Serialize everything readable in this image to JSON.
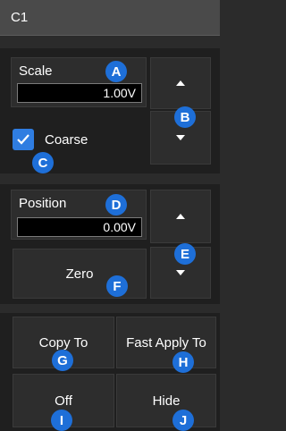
{
  "window": {
    "title": "C1"
  },
  "scale": {
    "label": "Scale",
    "value": "1.00V",
    "up_icon": "triangle-up",
    "down_icon": "triangle-down"
  },
  "coarse": {
    "label": "Coarse",
    "checked": true
  },
  "position": {
    "label": "Position",
    "value": "0.00V",
    "up_icon": "triangle-up",
    "down_icon": "triangle-down"
  },
  "zero": {
    "label": "Zero"
  },
  "actions": {
    "copy_to": "Copy To",
    "fast_apply_to": "Fast Apply To",
    "off": "Off",
    "hide": "Hide"
  },
  "markers": {
    "a": "A",
    "b": "B",
    "c": "C",
    "d": "D",
    "e": "E",
    "f": "F",
    "g": "G",
    "h": "H",
    "i": "I",
    "j": "J"
  },
  "colors": {
    "marker": "#1e6fd8",
    "checkbox": "#2f7de1",
    "background": "#2b2b2b",
    "panel": "#2d2d2d"
  }
}
